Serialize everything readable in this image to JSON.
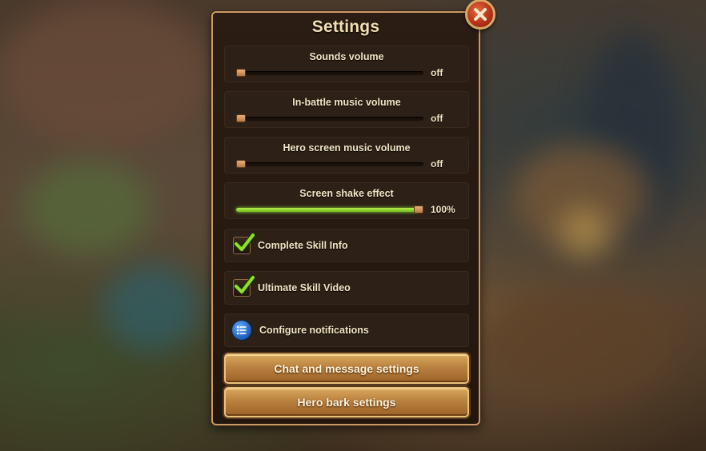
{
  "dialog": {
    "title": "Settings"
  },
  "sliders": [
    {
      "label": "Sounds volume",
      "value_text": "off",
      "level": 0.0
    },
    {
      "label": "In-battle music volume",
      "value_text": "off",
      "level": 0.0
    },
    {
      "label": "Hero screen music volume",
      "value_text": "off",
      "level": 0.0
    },
    {
      "label": "Screen shake effect",
      "value_text": "100%",
      "level": 1.0
    }
  ],
  "checkboxes": [
    {
      "label": "Complete Skill Info",
      "checked": true
    },
    {
      "label": "Ultimate Skill Video",
      "checked": true
    }
  ],
  "notifications": {
    "label": "Configure notifications",
    "icon": "list-icon"
  },
  "buttons": {
    "chat": "Chat and message settings",
    "hero_bark": "Hero bark settings"
  },
  "colors": {
    "accent_green": "#8ee03a",
    "panel_border": "#c99a63",
    "button_gold": "#b9813f",
    "close_red": "#b8331a"
  },
  "icons": {
    "close": "close-icon",
    "check": "checkmark-icon"
  }
}
